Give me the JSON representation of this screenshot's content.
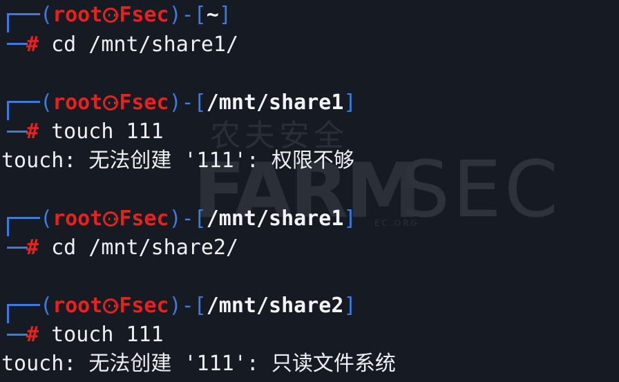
{
  "prompt": {
    "user": "root",
    "host": "Fsec",
    "hash": "#"
  },
  "blocks": [
    {
      "path": "~",
      "command": "cd /mnt/share1/",
      "output": ""
    },
    {
      "path": "/mnt/share1",
      "command": "touch 111",
      "output": "touch: 无法创建 '111': 权限不够"
    },
    {
      "path": "/mnt/share1",
      "command": "cd /mnt/share2/",
      "output": ""
    },
    {
      "path": "/mnt/share2",
      "command": "touch 111",
      "output": "touch: 无法创建 '111': 只读文件系统"
    }
  ],
  "watermark": {
    "cn": "农夫安全",
    "brand_bold": "FARM",
    "brand_light": "SEC",
    "domain": "EC.ORG"
  },
  "colors": {
    "background": "#161a22",
    "prompt_frame": "#3d7be3",
    "prompt_user": "#e8211d",
    "text": "#eef0f3"
  }
}
